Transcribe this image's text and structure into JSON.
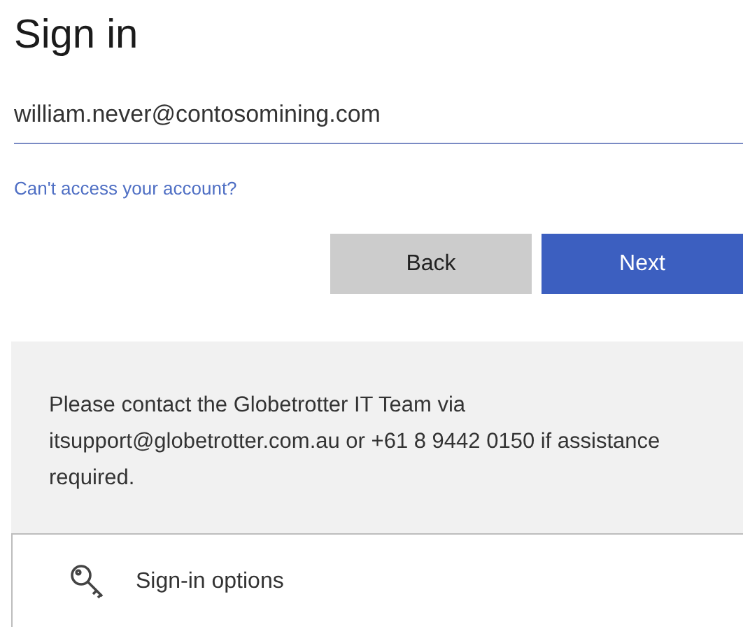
{
  "title": "Sign in",
  "email_field": {
    "value": "william.never@contosomining.com",
    "focused": true
  },
  "help_link": "Can't access your account?",
  "buttons": [
    {
      "label": "Back",
      "kind": "secondary"
    },
    {
      "label": "Next",
      "kind": "primary"
    }
  ],
  "notice": "Please contact the Globetrotter IT Team via itsupport@globetrotter.com.au or +61 8 9442 0150 if assistance required.",
  "options": {
    "label": "Sign-in options"
  }
}
